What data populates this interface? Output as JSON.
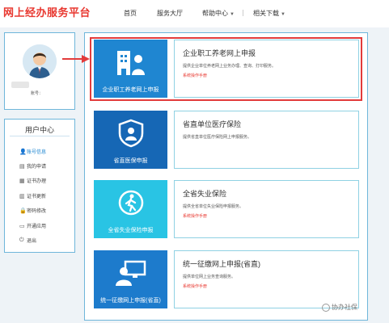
{
  "header": {
    "logo": "网上经办服务平台",
    "nav": [
      {
        "label": "首页",
        "has_caret": false
      },
      {
        "label": "服务大厅",
        "has_caret": false
      },
      {
        "label": "帮助中心",
        "has_caret": true
      },
      {
        "label": "相关下载",
        "has_caret": true
      }
    ]
  },
  "user": {
    "account_label": "账号："
  },
  "user_center": {
    "title": "用户中心",
    "items": [
      {
        "label": "账号信息",
        "icon": "user-icon",
        "glyph": "👤",
        "active": true
      },
      {
        "label": "我的申请",
        "icon": "document-icon",
        "glyph": "▤",
        "active": false
      },
      {
        "label": "证书办理",
        "icon": "certificate-icon",
        "glyph": "▦",
        "active": false
      },
      {
        "label": "证书更新",
        "icon": "certificate-refresh-icon",
        "glyph": "▥",
        "active": false
      },
      {
        "label": "密码修改",
        "icon": "lock-icon",
        "glyph": "🔒",
        "active": false
      },
      {
        "label": "开通应用",
        "icon": "folder-icon",
        "glyph": "▭",
        "active": false
      },
      {
        "label": "退出",
        "icon": "power-icon",
        "glyph": "⏻",
        "active": false
      }
    ]
  },
  "services": [
    {
      "tile_label": "企业职工养老网上申报",
      "tile_color": "#1f86d1",
      "icon": "pension-icon",
      "title": "企业职工养老网上申报",
      "desc": "提供企业单位养老网上业务办理、查询、打印服务。",
      "manual": "系统操作手册"
    },
    {
      "tile_label": "省直医保申报",
      "tile_color": "#1667b5",
      "icon": "shield-icon",
      "title": "省直单位医疗保险",
      "desc": "提供省直单位医疗保险网上申报服务。",
      "manual": ""
    },
    {
      "tile_label": "全省失业保险申报",
      "tile_color": "#29c4e4",
      "icon": "walker-icon",
      "title": "全省失业保险",
      "desc": "提供全省单位失业保险申报服务。",
      "manual": "系统操作手册"
    },
    {
      "tile_label": "统一征缴网上申报(省直)",
      "tile_color": "#1d7bcc",
      "icon": "monitor-user-icon",
      "title": "统一征缴网上申报(省直)",
      "desc": "提供单位网上业务查询服务。",
      "manual": "系统操作手册"
    }
  ],
  "watermark": "协办社保",
  "colors": {
    "accent": "#1f86d1",
    "brand_red": "#e8372f",
    "border": "#6fb6da"
  }
}
